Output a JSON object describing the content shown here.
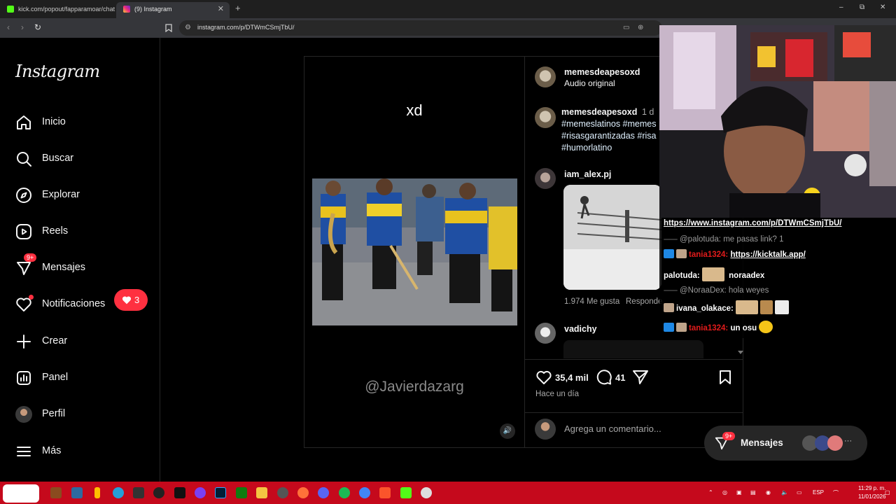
{
  "browser": {
    "tabs": [
      {
        "title": "kick.com/popout/fapparamoar/chat",
        "active": false
      },
      {
        "title": "(9) Instagram",
        "active": true
      }
    ],
    "new_tab": "+",
    "url": "instagram.com/p/DTWmCSmjTbU/",
    "win_min": "–",
    "win_max": "⧉",
    "win_close": "✕"
  },
  "instagram": {
    "logo": "Instagram",
    "nav": [
      {
        "key": "home",
        "label": "Inicio",
        "icon": "home-icon"
      },
      {
        "key": "search",
        "label": "Buscar",
        "icon": "search-icon"
      },
      {
        "key": "explore",
        "label": "Explorar",
        "icon": "compass-icon"
      },
      {
        "key": "reels",
        "label": "Reels",
        "icon": "reels-icon"
      },
      {
        "key": "messages",
        "label": "Mensajes",
        "icon": "messenger-icon",
        "badge": "9+"
      },
      {
        "key": "notifications",
        "label": "Notificaciones",
        "icon": "heart-icon"
      },
      {
        "key": "create",
        "label": "Crear",
        "icon": "plus-icon"
      },
      {
        "key": "dashboard",
        "label": "Panel",
        "icon": "dashboard-icon"
      },
      {
        "key": "profile",
        "label": "Perfil",
        "icon": "avatar"
      },
      {
        "key": "more",
        "label": "Más",
        "icon": "menu-icon"
      }
    ],
    "notif_count": "3"
  },
  "post": {
    "video_caption": "xd",
    "watermark": "@Javierdazarg",
    "author": "memesdeapesoxd",
    "audio": "Audio original",
    "caption_author": "memesdeapesoxd",
    "caption_time": "1 d",
    "hashtags_line1": "#memeslatinos #memes",
    "hashtags_line2": "#risasgarantizadas #risa",
    "hashtags_line3": "#humorlatino",
    "comment1_user": "iam_alex.pj",
    "comment1_likes": "1.974 Me gusta",
    "comment1_reply": "Responde",
    "comment2_user": "vadichy",
    "likes": "35,4 mil",
    "comments": "41",
    "time_ago": "Hace un día",
    "add_comment_placeholder": "Agrega un comentario..."
  },
  "chat": {
    "link": "https://www.instagram.com/p/DTWmCSmjTbU/",
    "line2_mention": "@palotuda: me pasas link? 1",
    "line3_user": "tania1324:",
    "line3_link": "https://kicktalk.app/",
    "line4_user": "palotuda:",
    "line4_text": "noraadex",
    "line5_mention": "@NoraaDex: hola weyes",
    "line6_user": "ivana_olakace:",
    "line7_user": "tania1324:",
    "line7_text": "un osu"
  },
  "messages_bubble": {
    "label": "Mensajes",
    "badge": "9+",
    "more": "···"
  },
  "taskbar": {
    "lang": "ESP",
    "time": "11:29 p. m.",
    "date": "11/01/2026",
    "accent": "#c5091c"
  }
}
